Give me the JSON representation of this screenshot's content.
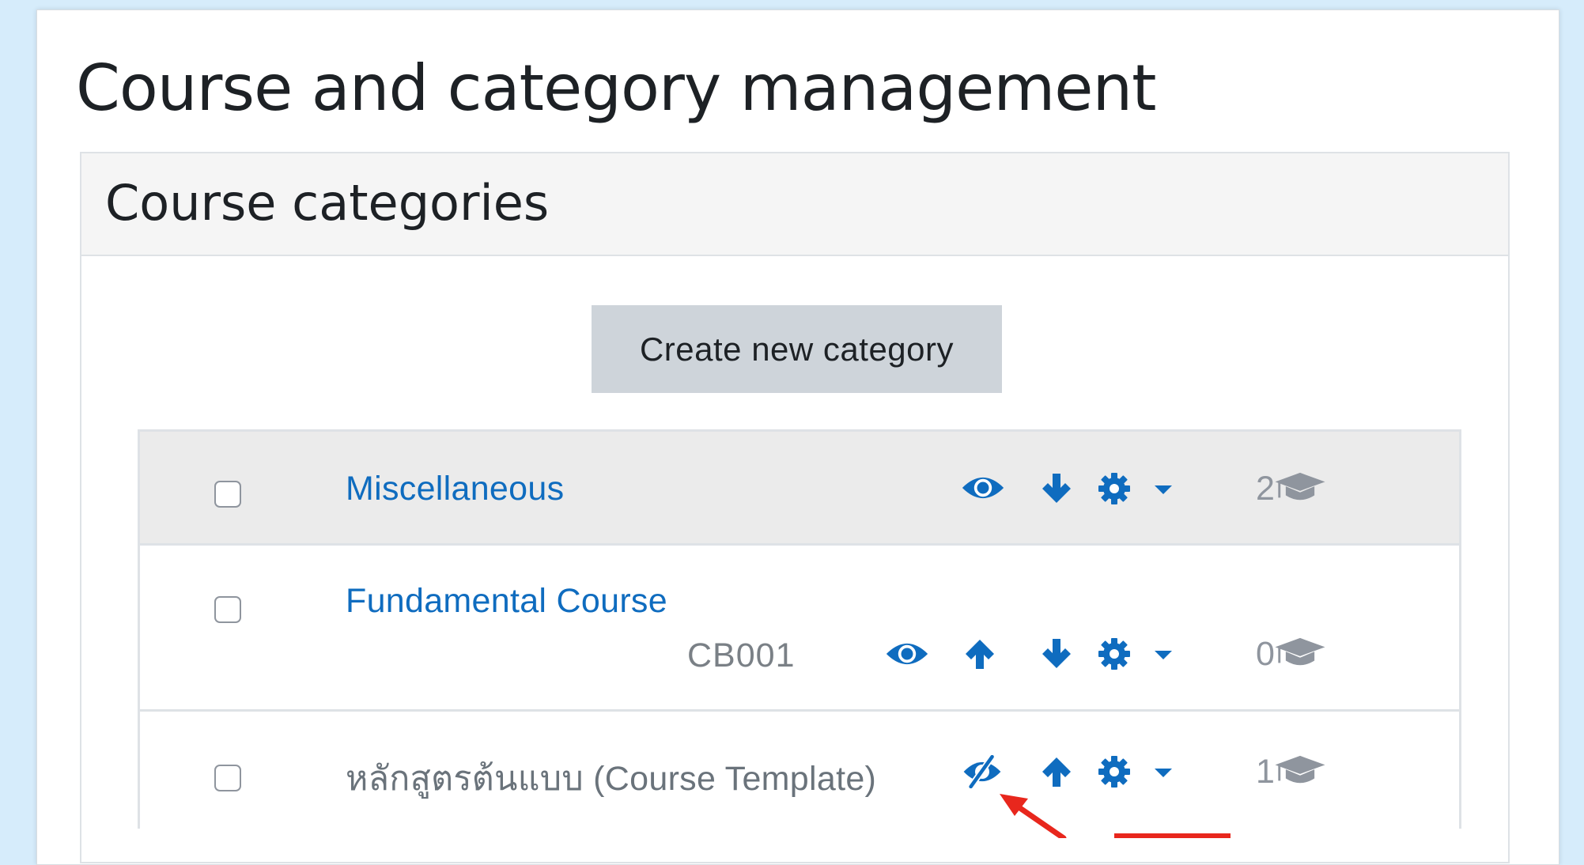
{
  "page": {
    "title": "Course and category management",
    "colors": {
      "link": "#0f6cbf",
      "muted": "#6a737b",
      "annotation": "#e8271d"
    }
  },
  "panel": {
    "title": "Course categories",
    "create_button": "Create new category"
  },
  "categories": [
    {
      "name": "Miscellaneous",
      "idnumber": "",
      "visible": true,
      "actions": [
        "eye-icon",
        "arrow-down-icon",
        "gear-icon",
        "caret-down-icon"
      ],
      "course_count": "2"
    },
    {
      "name": "Fundamental Course",
      "idnumber": "CB001",
      "visible": true,
      "actions": [
        "eye-icon",
        "arrow-up-icon",
        "arrow-down-icon",
        "gear-icon",
        "caret-down-icon"
      ],
      "course_count": "0"
    },
    {
      "name": "หลักสูตรต้นแบบ (Course Template)",
      "idnumber": "",
      "visible": false,
      "actions": [
        "eye-slash-icon",
        "arrow-up-icon",
        "gear-icon",
        "caret-down-icon"
      ],
      "course_count": "1"
    }
  ]
}
